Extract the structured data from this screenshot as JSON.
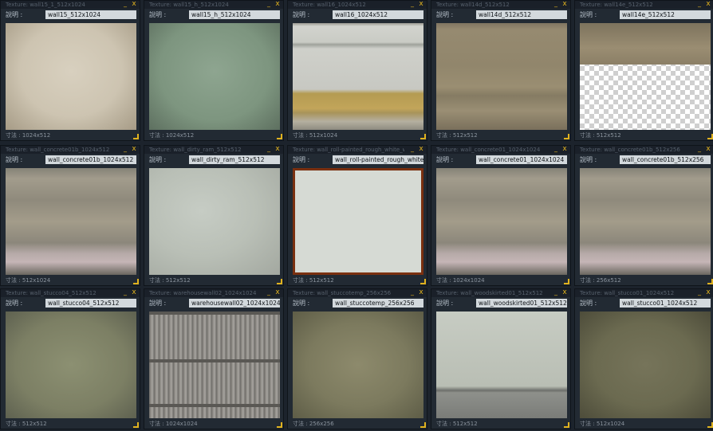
{
  "panel_common": {
    "desc_label": "說明 :",
    "size_prefix": "寸法 :",
    "min_glyph": "_",
    "close_glyph": "x",
    "minimize_icon": "minimize-icon",
    "close_icon": "close-icon"
  },
  "panels": [
    {
      "title": "Texture: wall15_1_512x1024",
      "name": "wall15_512x1024",
      "size": "1024x512",
      "texture": "beige"
    },
    {
      "title": "Texture: wall15_h_512x1024",
      "name": "wall15_h_512x1024",
      "size": "1024x512",
      "texture": "green"
    },
    {
      "title": "Texture: wall16_1024x512",
      "name": "wall16_1024x512",
      "size": "512x1024",
      "texture": "stripe"
    },
    {
      "title": "Texture: wall14d_512x512",
      "name": "wall14d_512x512",
      "size": "512x512",
      "texture": "tan"
    },
    {
      "title": "Texture: wall14e_512x512",
      "name": "wall14e_512x512",
      "size": "512x512",
      "texture": "checker"
    },
    {
      "title": "Texture: wall_concrete01b_1024x512",
      "name": "wall_concrete01b_1024x512",
      "size": "512x1024",
      "texture": "concrete"
    },
    {
      "title": "Texture: wall_dirty_ram_512x512",
      "name": "wall_dirty_ram_512x512",
      "size": "512x512",
      "texture": "dirty"
    },
    {
      "title": "Texture: wall_roll-painted_rough_white_w",
      "name": "wall_roll-painted_rough_white_w",
      "size": "512x512",
      "texture": "white"
    },
    {
      "title": "Texture: wall_concrete01_1024x1024",
      "name": "wall_concrete01_1024x1024",
      "size": "1024x1024",
      "texture": "concrete"
    },
    {
      "title": "Texture: wall_concrete01b_512x256",
      "name": "wall_concrete01b_512x256",
      "size": "256x512",
      "texture": "concrete"
    },
    {
      "title": "Texture: wall_stucco04_512x512",
      "name": "wall_stucco04_512x512",
      "size": "512x512",
      "texture": "stucco1"
    },
    {
      "title": "Texture: warehousewall02_1024x1024",
      "name": "warehousewall02_1024x1024",
      "size": "1024x1024",
      "texture": "wood"
    },
    {
      "title": "Texture: wall_stuccotemp_256x256",
      "name": "wall_stuccotemp_256x256",
      "size": "256x256",
      "texture": "stucco2"
    },
    {
      "title": "Texture: wall_woodskirted01_512x512",
      "name": "wall_woodskirted01_512x512",
      "size": "512x512",
      "texture": "wainscot"
    },
    {
      "title": "Texture: wall_stucco01_1024x512",
      "name": "wall_stucco01_1024x512",
      "size": "512x1024",
      "texture": "stucco3"
    }
  ]
}
